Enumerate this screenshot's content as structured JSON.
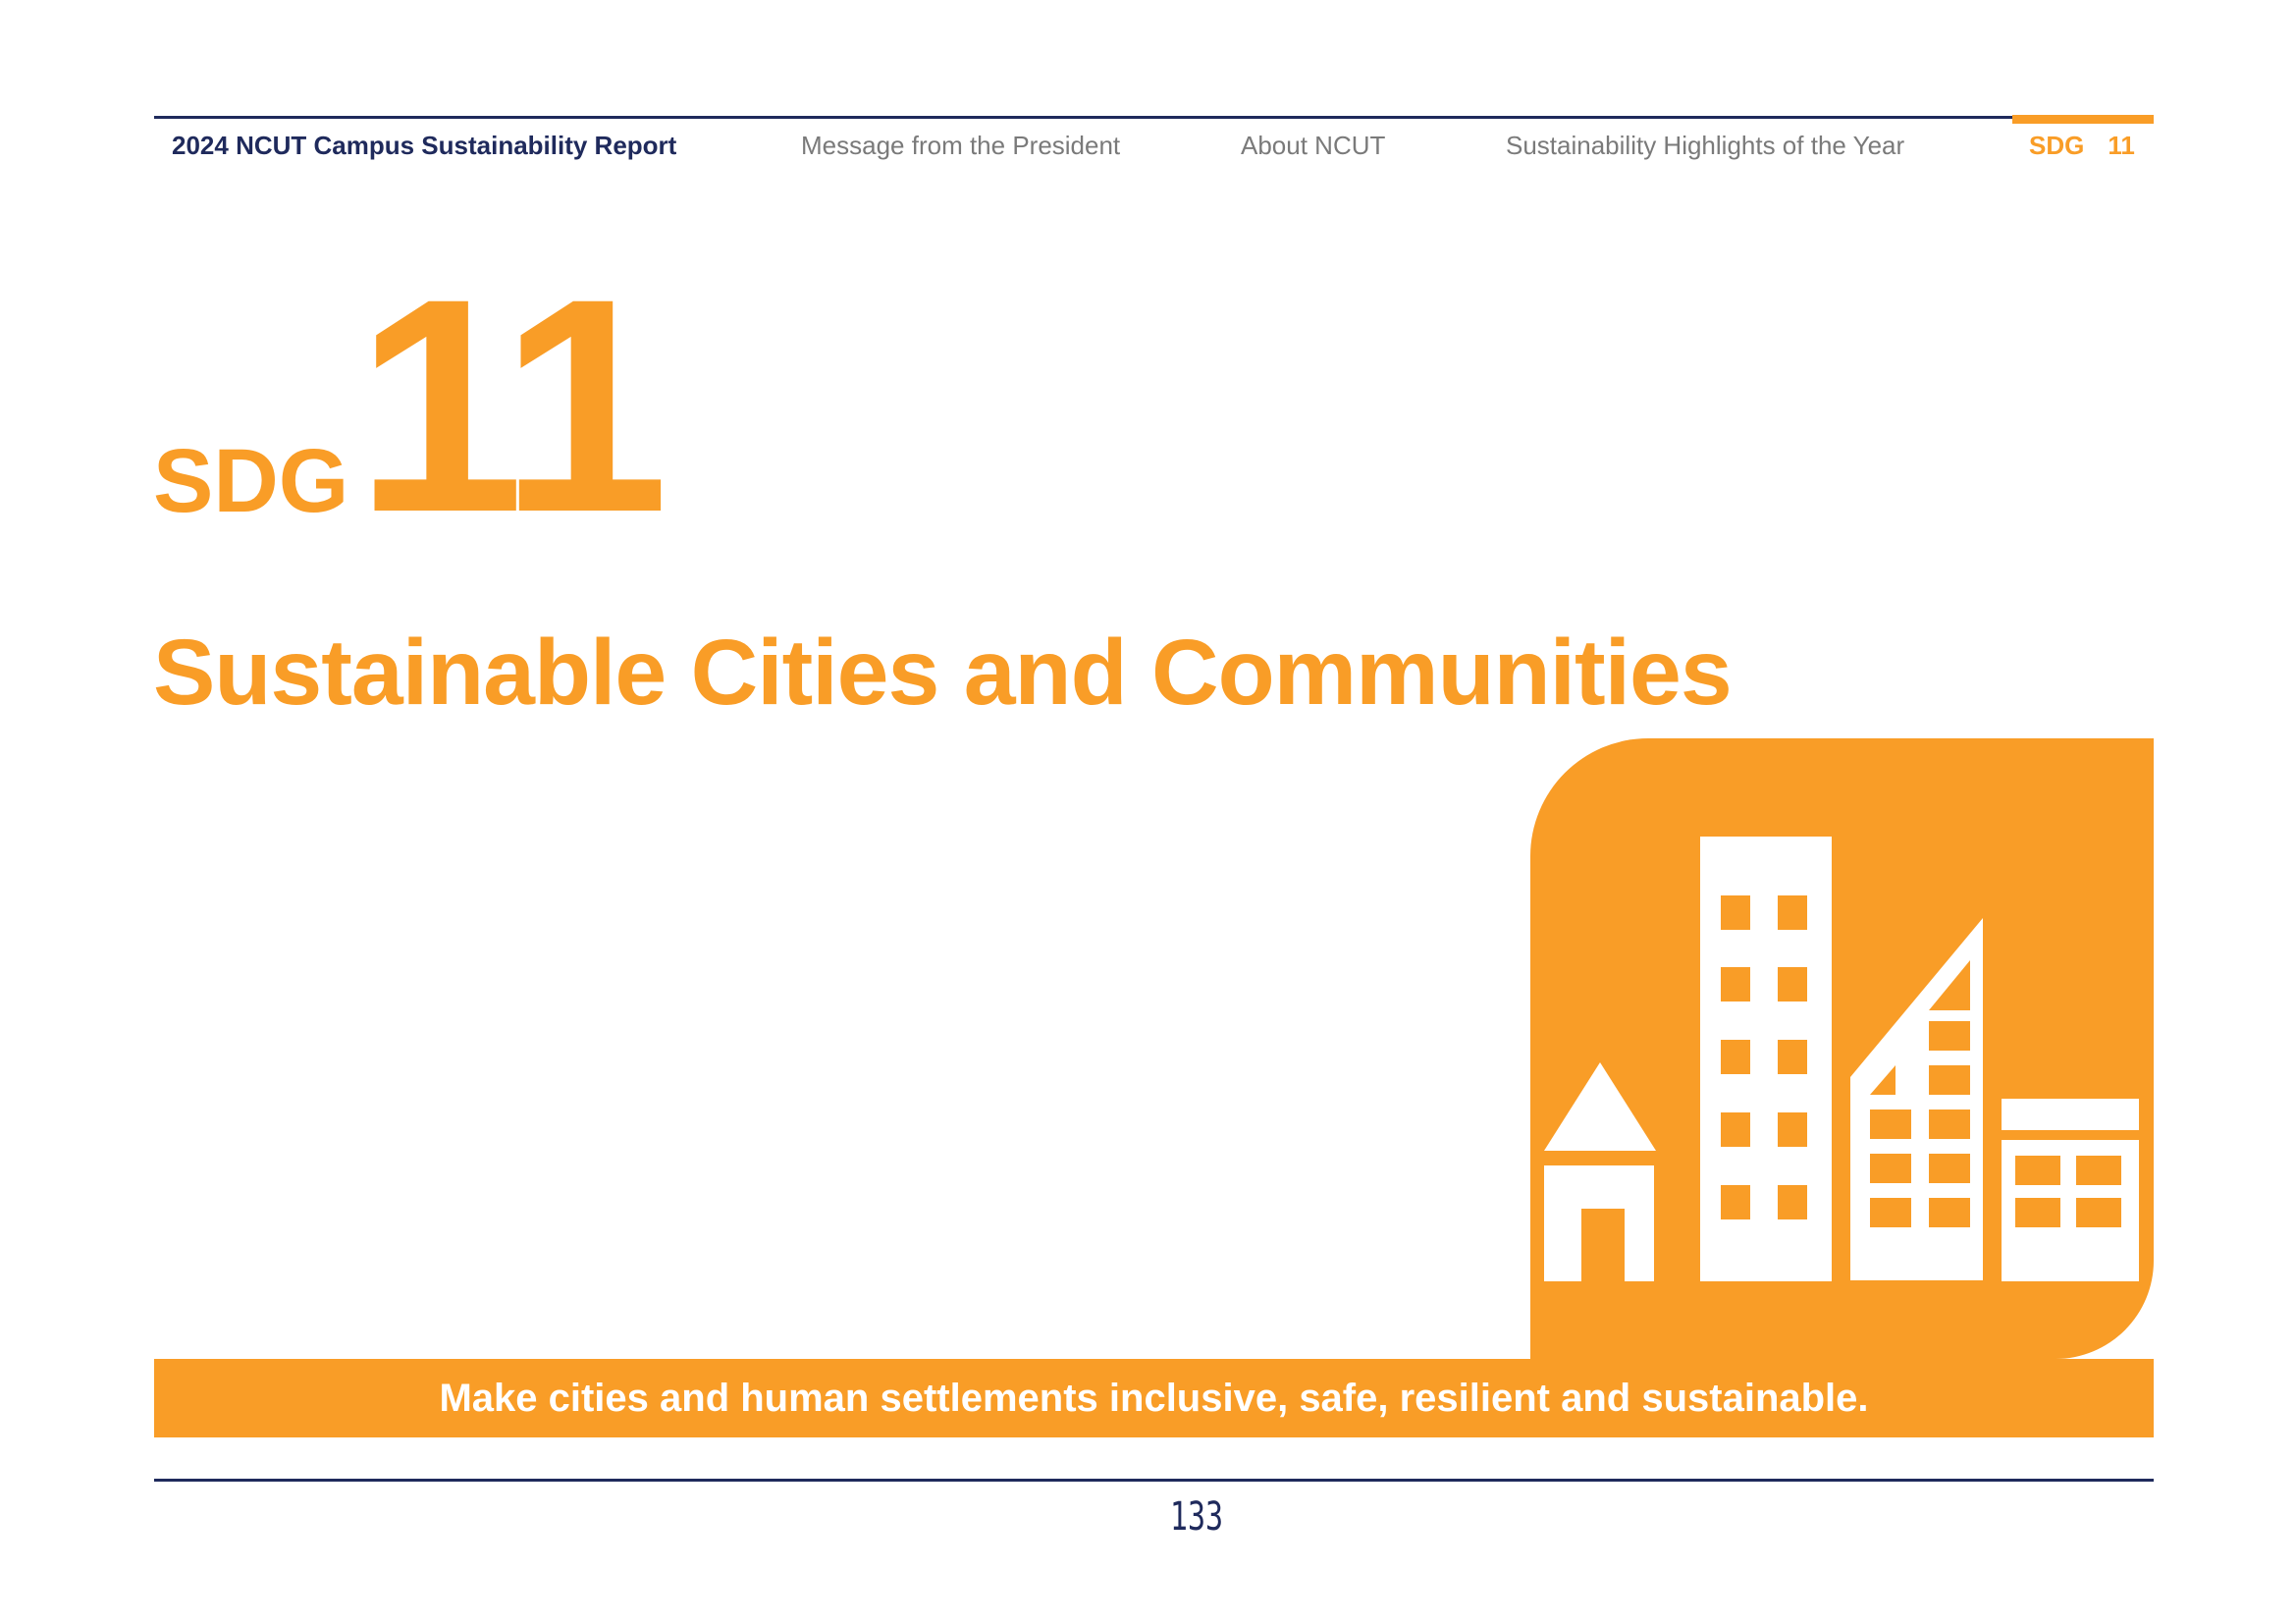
{
  "header": {
    "report_title": "2024 NCUT Campus Sustainability Report",
    "nav": [
      "Message from the President",
      "About NCUT",
      "Sustainability Highlights of the Year"
    ],
    "current_section": {
      "label": "SDG",
      "number": "11"
    }
  },
  "hero": {
    "sdg_label": "SDG",
    "sdg_number": "11",
    "goal_title": "Sustainable Cities and Communities"
  },
  "icon": "city-buildings-icon",
  "banner": {
    "text": "Make cities and human settlements inclusive, safe, resilient and sustainable."
  },
  "footer": {
    "page_number": "133"
  },
  "colors": {
    "accent": "#f99d27",
    "navy": "#1f2a5c",
    "nav_gray": "#7a7a7a",
    "white": "#ffffff"
  }
}
